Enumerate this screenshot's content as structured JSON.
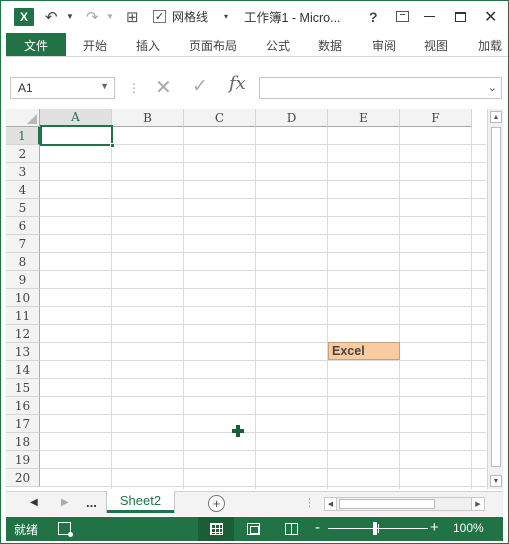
{
  "titlebar": {
    "app_icon": "excel-logo-icon",
    "app_icon_letter": "X",
    "gridlines_label": "网格线",
    "gridlines_checked": true,
    "title": "工作簿1 - Micro...",
    "help": "?",
    "close": "✕"
  },
  "ribbon": {
    "tabs": [
      "文件",
      "开始",
      "插入",
      "页面布局",
      "公式",
      "数据",
      "审阅",
      "视图",
      "加载"
    ]
  },
  "formula_bar": {
    "name_box": "A1",
    "fx": "fx",
    "formula": ""
  },
  "grid": {
    "columns": [
      "A",
      "B",
      "C",
      "D",
      "E",
      "F"
    ],
    "rows": [
      "1",
      "2",
      "3",
      "4",
      "5",
      "6",
      "7",
      "8",
      "9",
      "10",
      "11",
      "12",
      "13",
      "14",
      "15",
      "16",
      "17",
      "18",
      "19",
      "20"
    ],
    "active_cell": "A1",
    "cell_E13": "Excel",
    "cell_E13_fill": "#f8cba0"
  },
  "sheets": {
    "more": "...",
    "active_sheet": "Sheet2",
    "add": "+"
  },
  "status": {
    "ready": "就绪",
    "zoom_minus": "-",
    "zoom_plus": "+",
    "zoom": "100%"
  },
  "colors": {
    "accent": "#217346",
    "status_bar": "#217346",
    "highlight_cell": "#f8cba0"
  }
}
